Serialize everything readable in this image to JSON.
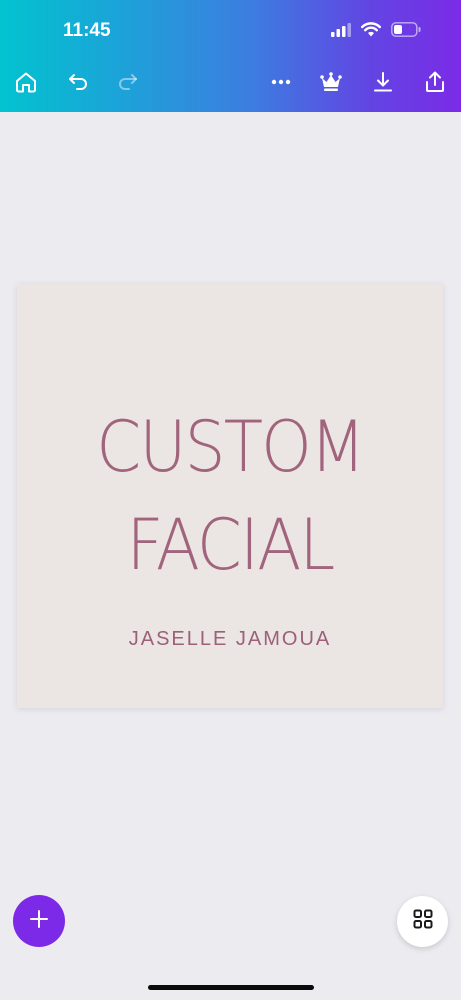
{
  "status_bar": {
    "time": "11:45",
    "icons": [
      "signal-icon",
      "wifi-icon",
      "battery-icon"
    ]
  },
  "toolbar": {
    "home_icon": "home-icon",
    "undo_icon": "undo-icon",
    "redo_icon": "redo-icon",
    "more_icon": "more-icon",
    "premium_icon": "crown-icon",
    "download_icon": "download-icon",
    "share_icon": "share-icon"
  },
  "design": {
    "title_line_1": "CUSTOM",
    "title_line_2": "FACIAL",
    "subtitle": "JASELLE JAMOUA"
  },
  "bottom": {
    "add_icon": "plus-icon",
    "pages_icon": "grid-icon"
  },
  "colors": {
    "gradient_start": "#02c3cf",
    "gradient_end": "#7b2be6",
    "design_background": "#ebe5e3",
    "design_text": "#a1647d",
    "fab": "#7d2ae8",
    "canvas_background": "#ebebf0"
  }
}
